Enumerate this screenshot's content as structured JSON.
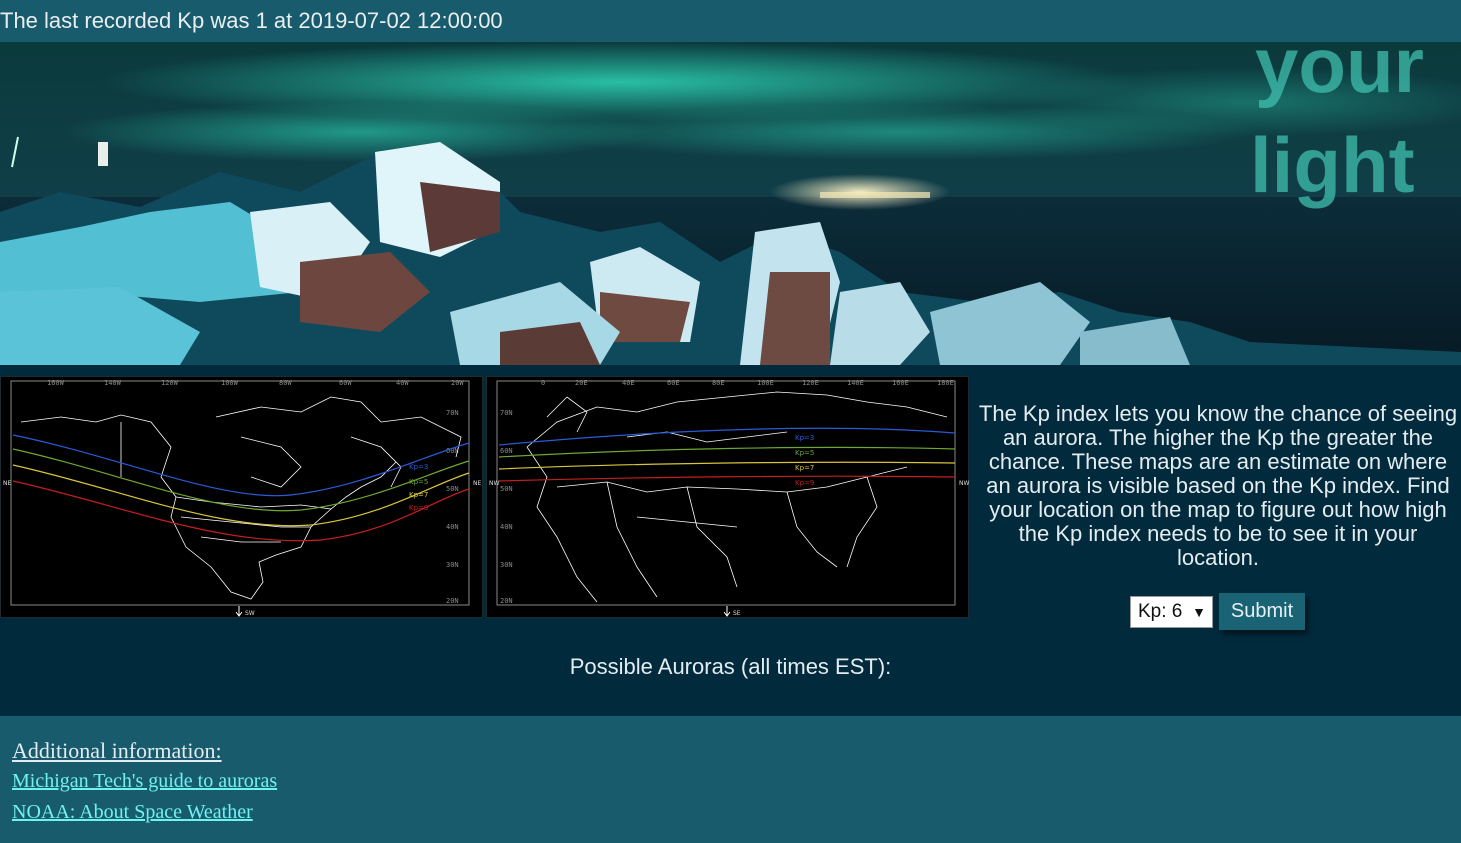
{
  "status": {
    "text": "The last recorded Kp was 1 at 2019-07-02 12:00:00"
  },
  "hero": {
    "overlay_text_line1": "your",
    "overlay_text_line2": "light"
  },
  "map_na": {
    "lon_labels": [
      "160W",
      "140W",
      "120W",
      "100W",
      "80W",
      "60W",
      "40W",
      "20W"
    ],
    "lat_labels": [
      "70N",
      "60N",
      "50N",
      "40N",
      "30N",
      "20N"
    ],
    "curve_labels": [
      "Kp=3",
      "Kp=5",
      "Kp=7",
      "Kp=9"
    ],
    "edge_labels": {
      "left": "NE",
      "right": "NE",
      "bottom": "SW"
    }
  },
  "map_eu": {
    "lon_labels": [
      "0",
      "20E",
      "40E",
      "60E",
      "80E",
      "100E",
      "120E",
      "140E",
      "160E",
      "180E"
    ],
    "lat_labels": [
      "70N",
      "60N",
      "50N",
      "40N",
      "30N",
      "20N"
    ],
    "curve_labels": [
      "Kp=3",
      "Kp=5",
      "Kp=7",
      "Kp=9"
    ],
    "edge_labels": {
      "left": "NW",
      "right": "NW",
      "bottom": "SE"
    }
  },
  "kp_colors": {
    "kp3": "#2a5bd7",
    "kp5": "#6ea832",
    "kp7": "#d8c43a",
    "kp9": "#c41f1f"
  },
  "description": "The Kp index lets you know the chance of seeing an aurora. The higher the Kp the greater the chance. These maps are an estimate on where an aurora is visible based on the Kp index. Find your location on the map to figure out how high the Kp index needs to be to see it in your location.",
  "form": {
    "selected": "Kp: 6",
    "submit_label": "Submit"
  },
  "auroras_heading": "Possible Auroras (all times EST):",
  "footer": {
    "heading": "Additional information:",
    "link1": "Michigan Tech's guide to auroras",
    "link2": "NOAA: About Space Weather"
  }
}
